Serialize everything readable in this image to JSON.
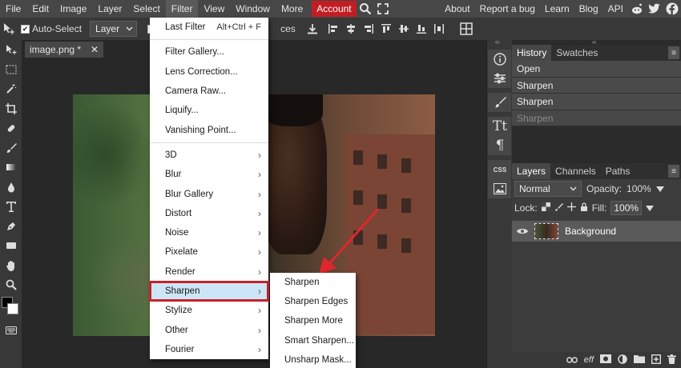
{
  "menubar": {
    "items": [
      "File",
      "Edit",
      "Image",
      "Layer",
      "Select",
      "Filter",
      "View",
      "Window",
      "More"
    ],
    "account": "Account",
    "right_links": [
      "About",
      "Report a bug",
      "Learn",
      "Blog",
      "API"
    ]
  },
  "options": {
    "auto_select": "Auto-Select",
    "layer_select": "Layer",
    "ces_fragment": "ces"
  },
  "document": {
    "tab": "image.png *",
    "close": "✕"
  },
  "filter_menu": {
    "last_filter": "Last Filter",
    "last_filter_shortcut": "Alt+Ctrl + F",
    "group1": [
      "Filter Gallery...",
      "Lens Correction...",
      "Camera Raw...",
      "Liquify...",
      "Vanishing Point..."
    ],
    "group2": [
      "3D",
      "Blur",
      "Blur Gallery",
      "Distort",
      "Noise",
      "Pixelate",
      "Render",
      "Sharpen",
      "Stylize",
      "Other",
      "Fourier"
    ]
  },
  "sharpen_submenu": [
    "Sharpen",
    "Sharpen Edges",
    "Sharpen More",
    "Smart Sharpen...",
    "Unsharp Mask..."
  ],
  "history_panel": {
    "tabs": [
      "History",
      "Swatches"
    ],
    "items": [
      "Open",
      "Sharpen",
      "Sharpen",
      "Sharpen"
    ]
  },
  "layers_panel": {
    "tabs": [
      "Layers",
      "Channels",
      "Paths"
    ],
    "blend_mode": "Normal",
    "opacity_label": "Opacity:",
    "opacity_value": "100%",
    "lock_label": "Lock:",
    "fill_label": "Fill:",
    "fill_value": "100%",
    "layer_name": "Background"
  },
  "footer_icons": [
    "link-icon",
    "effects-icon",
    "mask-icon",
    "adjustment-icon",
    "folder-icon",
    "new-layer-icon",
    "delete-icon"
  ],
  "colors": {
    "accent": "#c31d24",
    "highlight": "#cde6f7",
    "menubar": "#474747"
  }
}
